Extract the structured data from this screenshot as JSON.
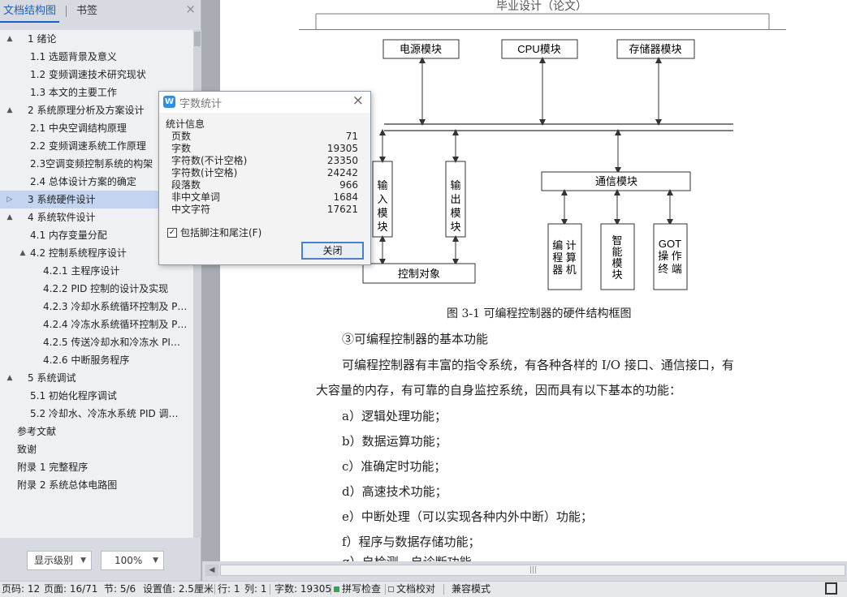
{
  "nav": {
    "tab_outline": "文档结构图",
    "tab_bookmark": "书签",
    "close_glyph": "×",
    "tree": [
      {
        "label": "1  绪论",
        "level": 0,
        "expander": "▲"
      },
      {
        "label": "1.1  选题背景及意义",
        "level": 1,
        "expander": ""
      },
      {
        "label": "1.2  变频调速技术研究现状",
        "level": 1,
        "expander": ""
      },
      {
        "label": "1.3  本文的主要工作",
        "level": 1,
        "expander": ""
      },
      {
        "label": "2  系统原理分析及方案设计",
        "level": 0,
        "expander": "▲"
      },
      {
        "label": "2.1  中央空调结构原理",
        "level": 1,
        "expander": ""
      },
      {
        "label": "2.2  变频调速系统工作原理",
        "level": 1,
        "expander": ""
      },
      {
        "label": "2.3空调变频控制系统的构架",
        "level": 1,
        "expander": ""
      },
      {
        "label": "2.4 总体设计方案的确定",
        "level": 1,
        "expander": ""
      },
      {
        "label": "3  系统硬件设计",
        "level": 0,
        "expander": "▷",
        "selected": true
      },
      {
        "label": "4  系统软件设计",
        "level": 0,
        "expander": "▲"
      },
      {
        "label": "4.1 内存变量分配",
        "level": 1,
        "expander": ""
      },
      {
        "label": "4.2  控制系统程序设计",
        "level": 1,
        "expander": "▲"
      },
      {
        "label": "4.2.1  主程序设计",
        "level": 2,
        "expander": ""
      },
      {
        "label": "4.2.2 PID 控制的设计及实现",
        "level": 2,
        "expander": ""
      },
      {
        "label": "4.2.3  冷却水系统循环控制及 P…",
        "level": 2,
        "expander": ""
      },
      {
        "label": "4.2.4  冷冻水系统循环控制及 P…",
        "level": 2,
        "expander": ""
      },
      {
        "label": "4.2.5  传送冷却水和冷冻水 PI…",
        "level": 2,
        "expander": ""
      },
      {
        "label": "4.2.6 中断服务程序",
        "level": 2,
        "expander": ""
      },
      {
        "label": "5  系统调试",
        "level": 0,
        "expander": "▲"
      },
      {
        "label": "5.1  初始化程序调试",
        "level": 1,
        "expander": ""
      },
      {
        "label": "5.2  冷却水、冷冻水系统 PID 调…",
        "level": 1,
        "expander": ""
      },
      {
        "label": "参考文献",
        "level": 0,
        "expander": ""
      },
      {
        "label": "致谢",
        "level": 0,
        "expander": ""
      },
      {
        "label": "附录 1  完整程序",
        "level": 0,
        "expander": ""
      },
      {
        "label": "附录 2  系统总体电路图",
        "level": 0,
        "expander": ""
      }
    ],
    "footer": {
      "level_label": "显示级别",
      "zoom_label": "100%",
      "dropdown_glyph": "▼"
    }
  },
  "document": {
    "header": "毕业设计（论文）",
    "diagram": {
      "power": "电源模块",
      "cpu": "CPU模块",
      "memory": "存储器模块",
      "input_chars": [
        "输",
        "入",
        "模",
        "块"
      ],
      "output_chars": [
        "输",
        "出",
        "模",
        "块"
      ],
      "comm": "通信模块",
      "programmer": [
        "编 计",
        "程 算",
        "器 机"
      ],
      "smart_chars": [
        "智",
        "能",
        "模",
        "块"
      ],
      "got": [
        "GOT",
        "操 作",
        "终 端"
      ],
      "control": "控制对象"
    },
    "caption": "图 3-1  可编程控制器的硬件结构框图",
    "heading": "③可编程控制器的基本功能",
    "p1_line1": "可编程控制器有丰富的指令系统，有各种各样的 I/O 接口、通信接口，有",
    "p1_line2": "大容量的内存，有可靠的自身监控系统，因而具有以下基本的功能：",
    "items": [
      "a）逻辑处理功能；",
      "b）数据运算功能；",
      "c）准确定时功能；",
      "d）高速技术功能；",
      "e）中断处理（可以实现各种内外中断）功能；",
      "f）程序与数据存储功能；",
      "g）自检测、自诊断功能"
    ],
    "scroll_grip": "|||",
    "scroll_left": "◀"
  },
  "dialog": {
    "title": "字数统计",
    "logo": "W",
    "close_glyph": "×",
    "group": "统计信息",
    "stats": [
      {
        "label": "页数",
        "value": "71"
      },
      {
        "label": "字数",
        "value": "19305"
      },
      {
        "label": "字符数(不计空格)",
        "value": "23350"
      },
      {
        "label": "字符数(计空格)",
        "value": "24242"
      },
      {
        "label": "段落数",
        "value": "966"
      },
      {
        "label": "非中文单词",
        "value": "1684"
      },
      {
        "label": "中文字符",
        "value": "17621"
      }
    ],
    "checkbox_label": "包括脚注和尾注(F)",
    "checkbox_mark": "✓",
    "close_button": "关闭"
  },
  "status": {
    "page_code": "页码: 12",
    "page": "页面: 16/71",
    "section": "节: 5/6",
    "setting": "设置值: 2.5厘米",
    "line": "行: 1",
    "column": "列: 1",
    "words": "字数: 19305",
    "spell": "拼写检查",
    "proof": "文档校对",
    "compat": "兼容模式"
  }
}
